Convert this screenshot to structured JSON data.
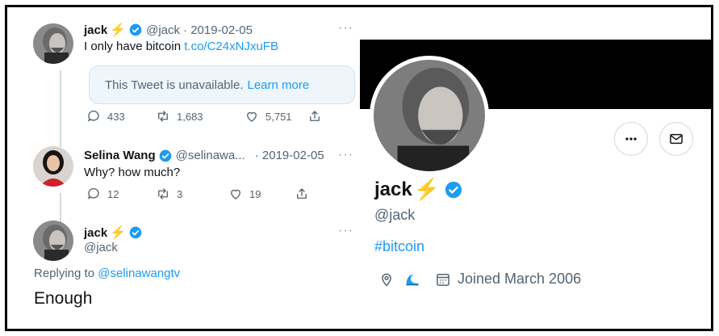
{
  "tweet1": {
    "name": "jack",
    "bolt": "⚡",
    "handle": "@jack",
    "date": "· 2019-02-05",
    "more": "···",
    "text": "I only have bitcoin",
    "link": "t.co/C24xNJxuFB",
    "quote_text": "This Tweet is unavailable.",
    "quote_link": "Learn more",
    "replies": "433",
    "retweets": "1,683",
    "likes": "5,751"
  },
  "tweet2": {
    "name": "Selina Wang",
    "handle": "@selinawa...",
    "date": "· 2019-02-05",
    "more": "···",
    "text": "Why? how much?",
    "replies": "12",
    "retweets": "3",
    "likes": "19"
  },
  "tweet3": {
    "name": "jack",
    "bolt": "⚡",
    "handle": "@jack",
    "more": "···",
    "replying_prefix": "Replying to",
    "replying_to": "@selinawangtv",
    "text": "Enough"
  },
  "profile": {
    "name": "jack",
    "bolt": "⚡",
    "handle": "@jack",
    "bio": "#bitcoin",
    "joined": "Joined March 2006"
  },
  "colors": {
    "accent": "#1d9bf0",
    "bolt": "#f5a623",
    "muted": "#536471"
  },
  "icons": [
    "reply-icon",
    "retweet-icon",
    "like-icon",
    "share-icon",
    "verified-icon",
    "more-icon",
    "message-icon",
    "location-icon",
    "wave-icon",
    "calendar-icon"
  ]
}
